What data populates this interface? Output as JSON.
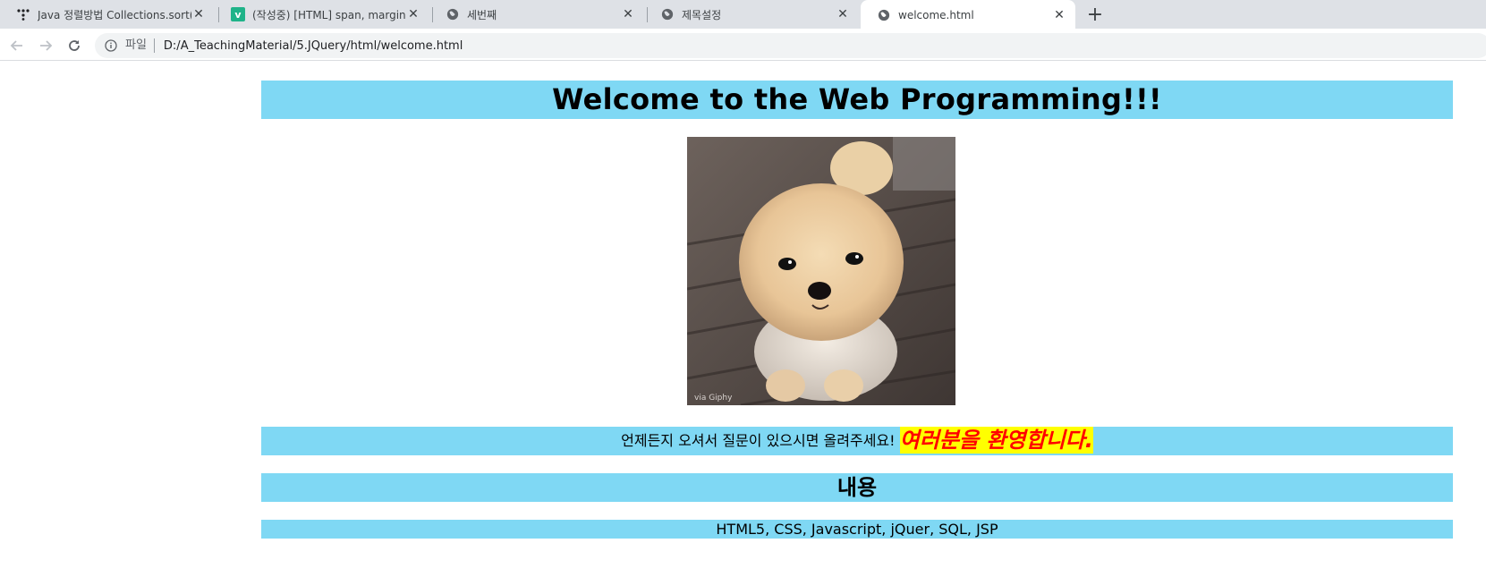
{
  "browser": {
    "tabs": [
      {
        "title": "Java 정렬방법 Collections.sort()",
        "icon": "dots-logo-icon"
      },
      {
        "title": "(작성중) [HTML] span, margin",
        "icon": "velog-v-icon"
      },
      {
        "title": "세번째",
        "icon": "globe-icon"
      },
      {
        "title": "제목설정",
        "icon": "globe-icon"
      },
      {
        "title": "welcome.html",
        "icon": "globe-icon"
      }
    ],
    "active_tab_index": 4,
    "close_glyph": "✕",
    "new_tab_glyph": "+",
    "address": {
      "chip_label": "파일",
      "url": "D:/A_TeachingMaterial/5.JQuery/html/welcome.html"
    }
  },
  "page": {
    "heading": "Welcome to the Web Programming!!!",
    "greeting_text": "언제든지 오셔서 질문이 있으시면 올려주세요!",
    "greeting_highlight": "여러분을 환영합니다.",
    "section_title": "내용",
    "topics": "HTML5, CSS, Javascript, jQuer, SQL, JSP",
    "photo_watermark": "via Giphy"
  },
  "colors": {
    "band": "#7fd8f4",
    "highlight_bg": "#ffff00",
    "highlight_text": "#ff0000",
    "tabstrip": "#dee1e6"
  }
}
